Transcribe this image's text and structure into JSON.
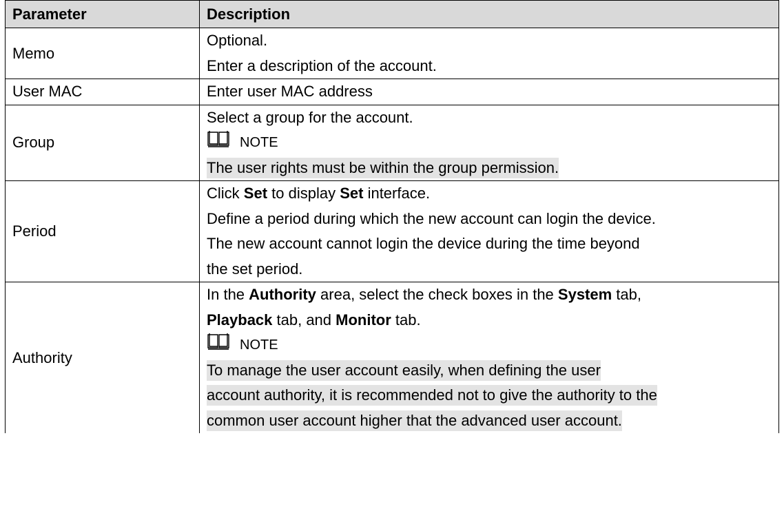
{
  "headers": {
    "parameter": "Parameter",
    "description": "Description"
  },
  "rows": {
    "memo": {
      "name": "Memo",
      "lines": [
        "Optional.",
        "Enter a description of the account."
      ]
    },
    "user_mac": {
      "name": "User MAC",
      "lines": [
        "Enter user MAC address"
      ]
    },
    "group": {
      "name": "Group",
      "line1": "Select a group for the account.",
      "note_label": "NOTE",
      "note_text": "The user rights must be within the group permission."
    },
    "period": {
      "name": "Period",
      "l1": {
        "a": "Click ",
        "b": "Set",
        "c": " to display ",
        "d": "Set",
        "e": " interface."
      },
      "l2": "Define a period during which the new account can login the device.",
      "l3": "The new account cannot login the device during the time beyond",
      "l4": "the set period."
    },
    "authority": {
      "name": "Authority",
      "l1": {
        "a": "In the ",
        "b": "Authority",
        "c": " area, select the check boxes in the ",
        "d": "System",
        "e": " tab,"
      },
      "l2": {
        "a": "Playback",
        "b": " tab, and ",
        "c": "Monitor",
        "d": " tab."
      },
      "note_label": "NOTE",
      "note_lines": [
        "To manage the user account easily, when defining the user",
        "account authority, it is recommended not to give the authority to the",
        "common user account higher that the advanced user account."
      ]
    }
  }
}
